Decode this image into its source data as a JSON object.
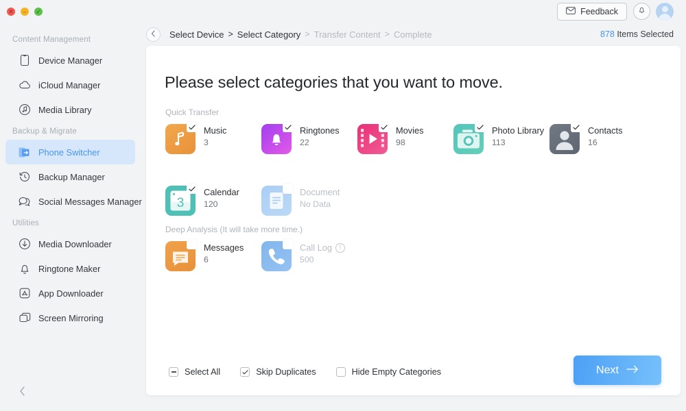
{
  "window": {
    "traffic_lights": [
      "close",
      "minimize",
      "maximize"
    ]
  },
  "sidebar": {
    "groups": [
      {
        "title": "Content Management",
        "items": [
          {
            "label": "Device Manager",
            "icon": "device-icon",
            "active": false
          },
          {
            "label": "iCloud Manager",
            "icon": "cloud-icon",
            "active": false
          },
          {
            "label": "Media Library",
            "icon": "music-note-circle-icon",
            "active": false
          }
        ]
      },
      {
        "title": "Backup & Migrate",
        "items": [
          {
            "label": "Phone Switcher",
            "icon": "phone-switcher-icon",
            "active": true
          },
          {
            "label": "Backup Manager",
            "icon": "clock-restore-icon",
            "active": false
          },
          {
            "label": "Social Messages Manager",
            "icon": "chat-bubbles-icon",
            "active": false
          }
        ]
      },
      {
        "title": "Utilities",
        "items": [
          {
            "label": "Media Downloader",
            "icon": "download-circle-icon",
            "active": false
          },
          {
            "label": "Ringtone Maker",
            "icon": "bell-icon",
            "active": false
          },
          {
            "label": "App Downloader",
            "icon": "app-store-icon",
            "active": false
          },
          {
            "label": "Screen Mirroring",
            "icon": "screens-icon",
            "active": false
          }
        ]
      }
    ],
    "collapse_label": "collapse-sidebar"
  },
  "topbar": {
    "feedback_label": "Feedback",
    "feedback_icon": "envelope-icon",
    "notification_icon": "bell-icon",
    "avatar_icon": "user-avatar"
  },
  "breadcrumb": {
    "back_icon": "chevron-left-icon",
    "steps": [
      {
        "label": "Select Device",
        "state": "done"
      },
      {
        "label": "Select Category",
        "state": "current"
      },
      {
        "label": "Transfer Content",
        "state": "pending"
      },
      {
        "label": "Complete",
        "state": "pending"
      }
    ],
    "separator": ">"
  },
  "status": {
    "items_count": "878",
    "items_label": "Items Selected"
  },
  "main": {
    "title": "Please select categories that you want to move.",
    "sections": [
      {
        "id": "quick-transfer",
        "label": "Quick Transfer",
        "categories": [
          {
            "name": "Music",
            "count": "3",
            "icon": "music-note-icon",
            "checked": true,
            "disabled": false,
            "color": "#ef9a3e"
          },
          {
            "name": "Ringtones",
            "count": "22",
            "icon": "bell-icon",
            "checked": true,
            "disabled": false,
            "color": "#b83cf0"
          },
          {
            "name": "Movies",
            "count": "98",
            "icon": "film-play-icon",
            "checked": true,
            "disabled": false,
            "color": "#ec3f7e"
          },
          {
            "name": "Photo Library",
            "count": "113",
            "icon": "camera-icon",
            "checked": true,
            "disabled": false,
            "color": "#4fc0b6"
          },
          {
            "name": "Contacts",
            "count": "16",
            "icon": "person-icon",
            "checked": true,
            "disabled": false,
            "color": "#6c7380"
          },
          {
            "name": "Calendar",
            "count": "120",
            "icon": "calendar-3-icon",
            "checked": true,
            "disabled": false,
            "color": "#4fc0b6"
          },
          {
            "name": "Document",
            "count": "No Data",
            "icon": "document-icon",
            "checked": false,
            "disabled": true,
            "color": "#a8cdf2"
          }
        ]
      },
      {
        "id": "deep-analysis",
        "label": "Deep Analysis (It will take more time.)",
        "categories": [
          {
            "name": "Messages",
            "count": "6",
            "icon": "message-card-icon",
            "checked": false,
            "disabled": false,
            "color": "#ef9a3e"
          },
          {
            "name": "Call Log",
            "count": "500",
            "icon": "phone-icon",
            "checked": false,
            "disabled": true,
            "color": "#7db3ea",
            "info_icon": "info-icon"
          }
        ]
      }
    ]
  },
  "footer": {
    "options": [
      {
        "label": "Select All",
        "state": "indeterminate"
      },
      {
        "label": "Skip Duplicates",
        "state": "checked"
      },
      {
        "label": "Hide Empty Categories",
        "state": "unchecked"
      }
    ],
    "next_label": "Next",
    "next_icon": "arrow-right-icon"
  },
  "colors": {
    "accent": "#4a94ef",
    "card_bg": "#ffffff",
    "app_bg": "#f2f3f5"
  }
}
